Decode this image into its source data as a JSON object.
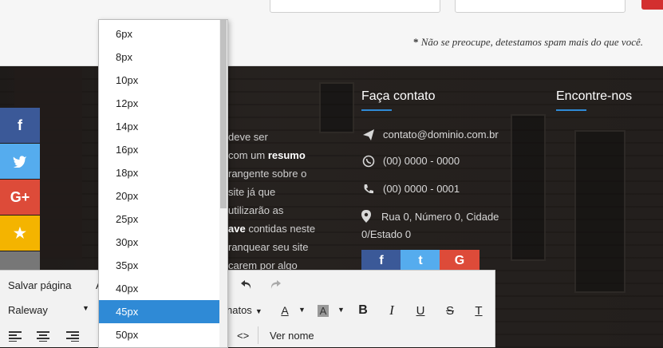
{
  "top": {
    "spam_note_star": "*",
    "spam_note": "Não se preocupe, detestamos spam mais do que você."
  },
  "body_text_lines": [
    {
      "pre": "deve ser",
      "bold": "",
      "post": ""
    },
    {
      "pre": "com um ",
      "bold": "resumo",
      "post": ""
    },
    {
      "pre": "rangente sobre o",
      "bold": "",
      "post": ""
    },
    {
      "pre": "site já que",
      "bold": "",
      "post": ""
    },
    {
      "pre": "utilizarão as",
      "bold": "",
      "post": ""
    },
    {
      "pre": "",
      "bold": "ave",
      "post": " contidas neste"
    },
    {
      "pre": "ranquear seu site",
      "bold": "",
      "post": ""
    },
    {
      "pre": "carem por algo",
      "bold": "",
      "post": ""
    }
  ],
  "contact": {
    "heading": "Faça contato",
    "email": "contato@dominio.com.br",
    "whatsapp": "(00) 0000 - 0000",
    "phone": "(00) 0000 - 0001",
    "address_line1": "Rua 0, Número 0, Cidade",
    "address_line2": "0/Estado 0"
  },
  "find_us": {
    "heading": "Encontre-nos"
  },
  "share_bar": [
    {
      "name": "facebook",
      "glyph": "f",
      "color": "#3b5998"
    },
    {
      "name": "twitter",
      "glyph": "t",
      "color": "#55acee"
    },
    {
      "name": "google-plus",
      "glyph": "G+",
      "color": "#dd4b39"
    },
    {
      "name": "favorite",
      "glyph": "★",
      "color": "#f4b400"
    },
    {
      "name": "more",
      "glyph": "",
      "color": "#777777"
    }
  ],
  "footer_social": [
    {
      "name": "facebook",
      "glyph": "f",
      "color": "#3b5998"
    },
    {
      "name": "twitter",
      "glyph": "t",
      "color": "#55acee"
    },
    {
      "name": "google-plus",
      "glyph": "G",
      "color": "#dd4b39"
    }
  ],
  "toolbar": {
    "save_label": "Salvar página",
    "font_family": "Raleway",
    "formats_label": "natos",
    "text_color_label": "A",
    "bg_color_label": "A",
    "bold": "B",
    "italic": "I",
    "underline": "U",
    "strike": "S",
    "clear": "T",
    "code_label": "<>",
    "view_name_label": "Ver nome",
    "partial_label": "A"
  },
  "font_size_dropdown": {
    "options": [
      "6px",
      "8px",
      "10px",
      "12px",
      "14px",
      "16px",
      "18px",
      "20px",
      "25px",
      "30px",
      "35px",
      "40px",
      "45px",
      "50px"
    ],
    "selected": "45px"
  }
}
